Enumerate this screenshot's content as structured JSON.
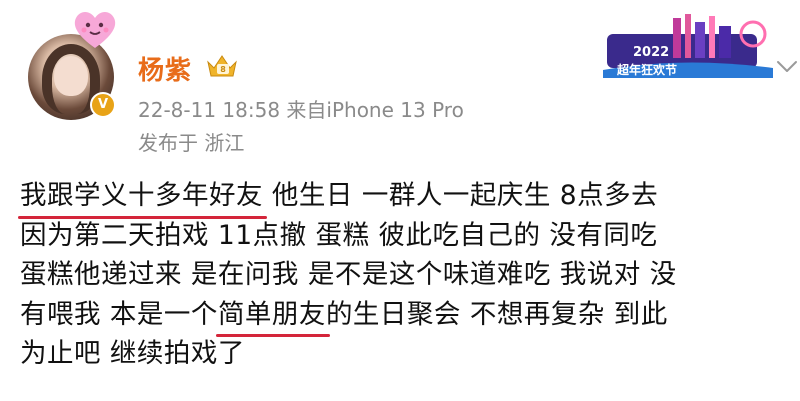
{
  "post": {
    "author": "杨紫",
    "time_source": "22-8-11 18:58  来自iPhone 13 Pro",
    "location": "发布于 浙江",
    "event_banner_text": "2022 超年狂欢节",
    "lines": [
      {
        "pre": "",
        "hl": "我跟学义十多年好友",
        "post": " 他生日 一群人一起庆生 8点多去"
      },
      {
        "pre": "因为第二天拍戏 11点撤  蛋糕 彼此吃自己的 没有同吃",
        "hl": "",
        "post": ""
      },
      {
        "pre": "蛋糕他递过来 是在问我 是不是这个味道难吃 我说对  没",
        "hl": "",
        "post": ""
      },
      {
        "pre": "有喂我  本是一个",
        "hl": "简单朋友",
        "post": "的生日聚会 不想再复杂 到此"
      },
      {
        "pre": "为止吧 继续拍戏了",
        "hl": "",
        "post": ""
      }
    ]
  },
  "colors": {
    "author": "#e86c1a",
    "meta": "#8a8a8a",
    "underline": "#d4253a",
    "text": "#111111"
  },
  "icons": [
    "heart-sticker-icon",
    "crown-badge-icon",
    "verified-v-icon",
    "chevron-down-icon"
  ]
}
